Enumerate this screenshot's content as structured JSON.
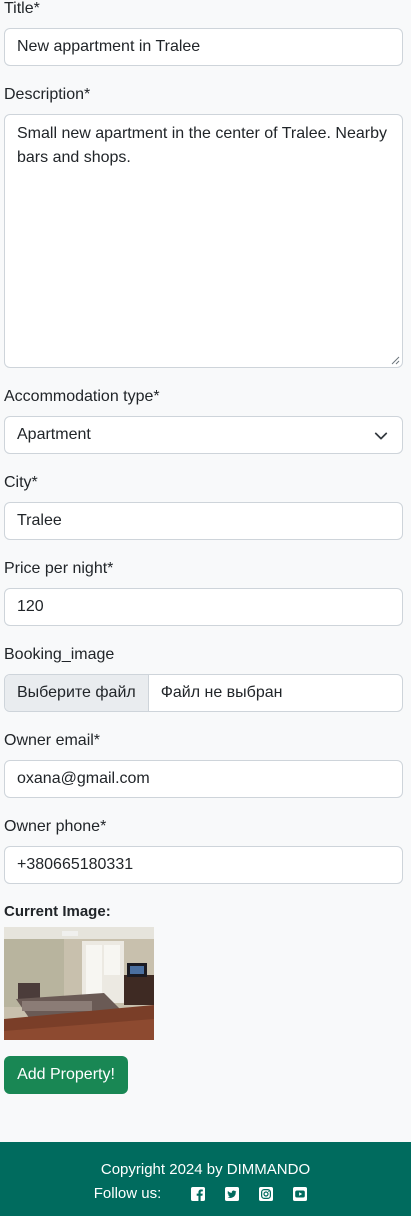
{
  "form": {
    "title": {
      "label": "Title*",
      "value": "New appartment in Tralee"
    },
    "description": {
      "label": "Description*",
      "value": "Small new apartment in the center of Tralee. Nearby bars and shops."
    },
    "accommodation_type": {
      "label": "Accommodation type*",
      "value": "Apartment"
    },
    "city": {
      "label": "City*",
      "value": "Tralee"
    },
    "price": {
      "label": "Price per night*",
      "value": "120"
    },
    "booking_image": {
      "label": "Booking_image",
      "button": "Выберите файл",
      "status": "Файл не выбран"
    },
    "owner_email": {
      "label": "Owner email*",
      "value": "oxana@gmail.com"
    },
    "owner_phone": {
      "label": "Owner phone*",
      "value": "+380665180331"
    },
    "current_image_label": "Current Image:",
    "submit_label": "Add Property!"
  },
  "footer": {
    "copyright": "Copyright 2024 by DIMMANDO",
    "follow_label": "Follow us:",
    "social_icons": [
      "facebook-icon",
      "twitter-icon",
      "instagram-icon",
      "youtube-icon"
    ]
  },
  "colors": {
    "primary_button": "#198754",
    "footer_bg": "#006b5e",
    "page_bg": "#f8f9fa"
  }
}
